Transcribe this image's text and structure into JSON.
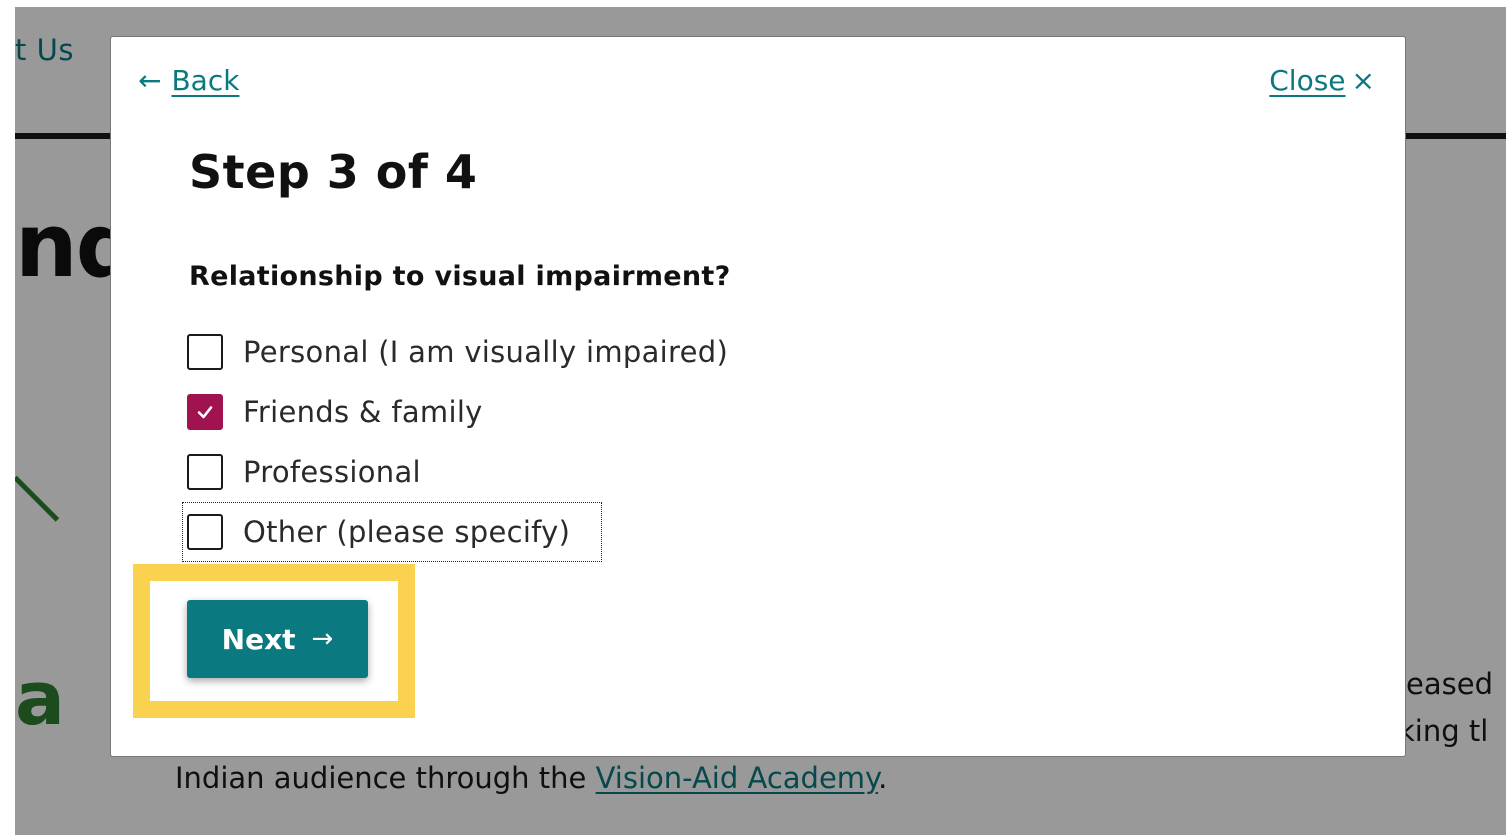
{
  "background": {
    "nav_text": "t Us",
    "heading_fragment": "nd",
    "logo_fragment": "a",
    "right_text_1": "leased",
    "right_text_2": "king tl",
    "bottom_text_prefix": "Indian audience through the ",
    "bottom_link": "Vision-Aid Academy",
    "bottom_text_suffix": "."
  },
  "modal": {
    "back_arrow": "←",
    "back_label": "Back",
    "close_label": "Close",
    "close_icon": "×",
    "step_title": "Step 3 of 4",
    "question": "Relationship to visual impairment?",
    "options": [
      {
        "label": "Personal (I am visually impaired)",
        "checked": false
      },
      {
        "label": "Friends & family",
        "checked": true
      },
      {
        "label": "Professional",
        "checked": false
      },
      {
        "label": "Other (please specify)",
        "checked": false,
        "focused": true
      }
    ],
    "next_label": "Next",
    "next_arrow": "→"
  },
  "colors": {
    "accent": "#0b7a80",
    "checkbox_checked": "#a0134f",
    "highlight": "#fad250"
  }
}
